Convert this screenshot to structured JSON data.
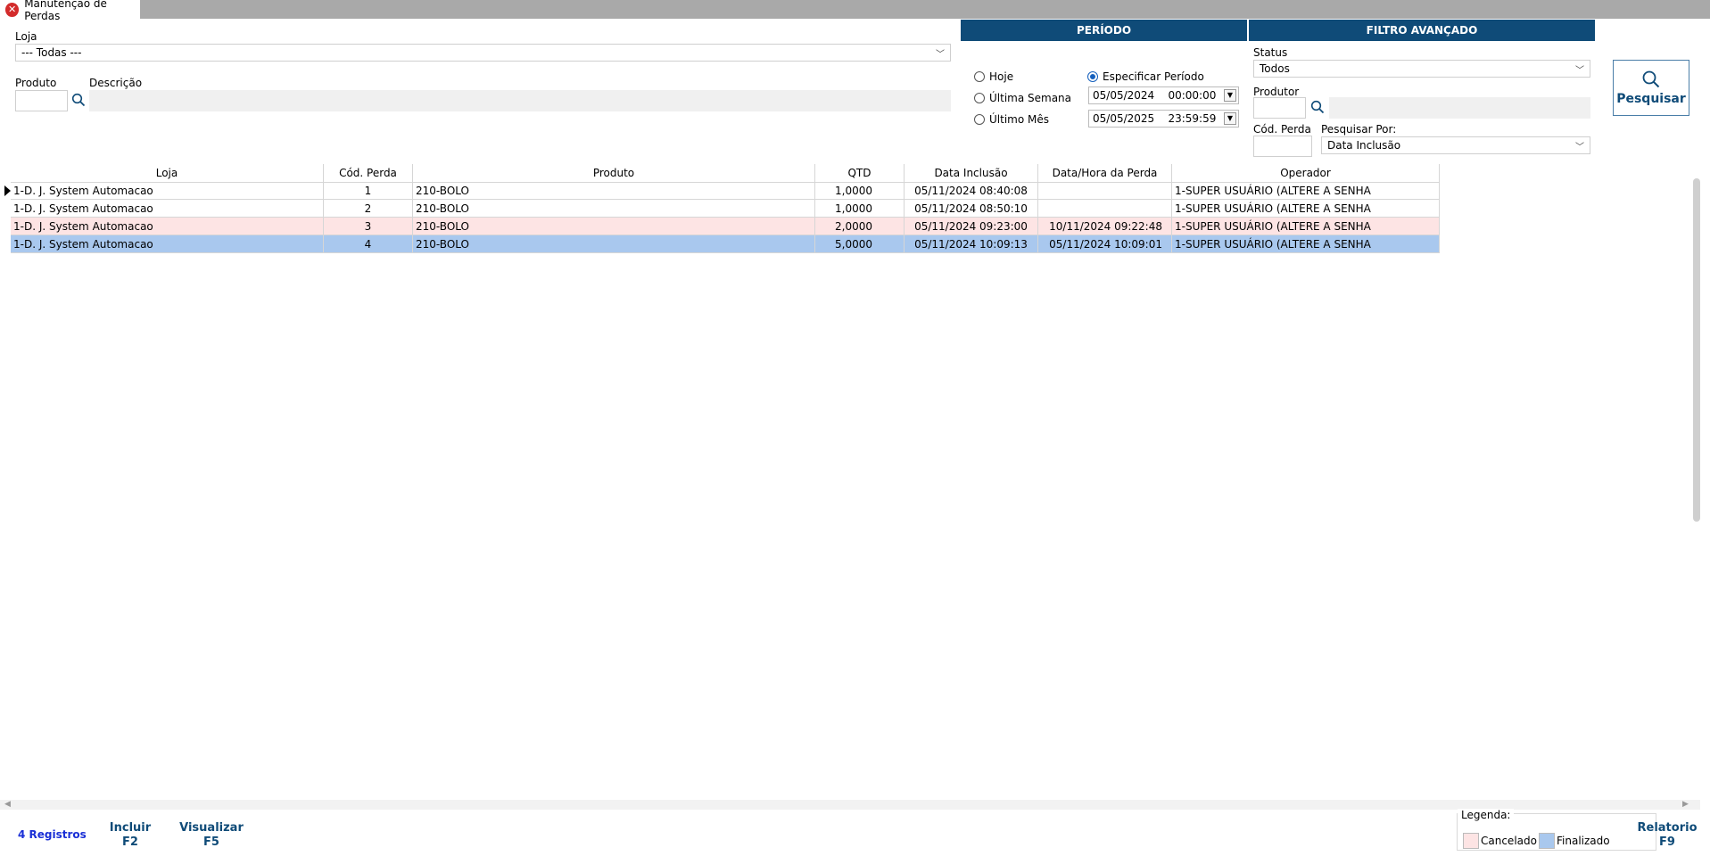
{
  "window": {
    "tab_title": "Manutenção de Perdas",
    "close_glyph": "✕"
  },
  "filters": {
    "loja_label": "Loja",
    "loja_value": "--- Todas ---",
    "produto_label": "Produto",
    "descricao_label": "Descrição"
  },
  "periodo": {
    "title": "PERÍODO",
    "options": [
      "Hoje",
      "Última Semana",
      "Último Mês",
      "Especificar Período"
    ],
    "selected": "Especificar Período",
    "start": {
      "date": "05/05/2024",
      "time": "00:00:00"
    },
    "end": {
      "date": "05/05/2025",
      "time": "23:59:59"
    }
  },
  "filtro": {
    "title": "FILTRO AVANÇADO",
    "status_label": "Status",
    "status_value": "Todos",
    "produtor_label": "Produtor",
    "cod_perda_label": "Cód. Perda",
    "pesquisar_por_label": "Pesquisar Por:",
    "pesquisar_por_value": "Data Inclusão"
  },
  "search_button": {
    "label": "Pesquisar"
  },
  "grid": {
    "columns": [
      "Loja",
      "Cód. Perda",
      "Produto",
      "QTD",
      "Data Inclusão",
      "Data/Hora da Perda",
      "Operador"
    ],
    "rows": [
      {
        "loja": "1-D. J. System Automacao",
        "cod": "1",
        "produto": "210-BOLO",
        "qtd": "1,0000",
        "inclusao": "05/11/2024 08:40:08",
        "perda": "",
        "operador": "1-SUPER USUÁRIO (ALTERE A SENHA",
        "status": "normal",
        "current": true
      },
      {
        "loja": "1-D. J. System Automacao",
        "cod": "2",
        "produto": "210-BOLO",
        "qtd": "1,0000",
        "inclusao": "05/11/2024 08:50:10",
        "perda": "",
        "operador": "1-SUPER USUÁRIO (ALTERE A SENHA",
        "status": "normal",
        "current": false
      },
      {
        "loja": "1-D. J. System Automacao",
        "cod": "3",
        "produto": "210-BOLO",
        "qtd": "2,0000",
        "inclusao": "05/11/2024 09:23:00",
        "perda": "10/11/2024 09:22:48",
        "operador": "1-SUPER USUÁRIO (ALTERE A SENHA",
        "status": "cancel",
        "current": false
      },
      {
        "loja": "1-D. J. System Automacao",
        "cod": "4",
        "produto": "210-BOLO",
        "qtd": "5,0000",
        "inclusao": "05/11/2024 10:09:13",
        "perda": "05/11/2024 10:09:01",
        "operador": "1-SUPER USUÁRIO (ALTERE A SENHA",
        "status": "final",
        "current": false
      }
    ]
  },
  "footer": {
    "records": "4 Registros",
    "incluir": "Incluir",
    "incluir_key": "F2",
    "visualizar": "Visualizar",
    "visualizar_key": "F5",
    "relatorio": "Relatorio",
    "relatorio_key": "F9",
    "legend_title": "Legenda:",
    "legend_cancelado": "Cancelado",
    "legend_finalizado": "Finalizado"
  },
  "colors": {
    "header_blue": "#0f4b78",
    "cancel_row": "#fde4e4",
    "final_row": "#a9c8ee",
    "link_blue": "#1a2fd6"
  }
}
